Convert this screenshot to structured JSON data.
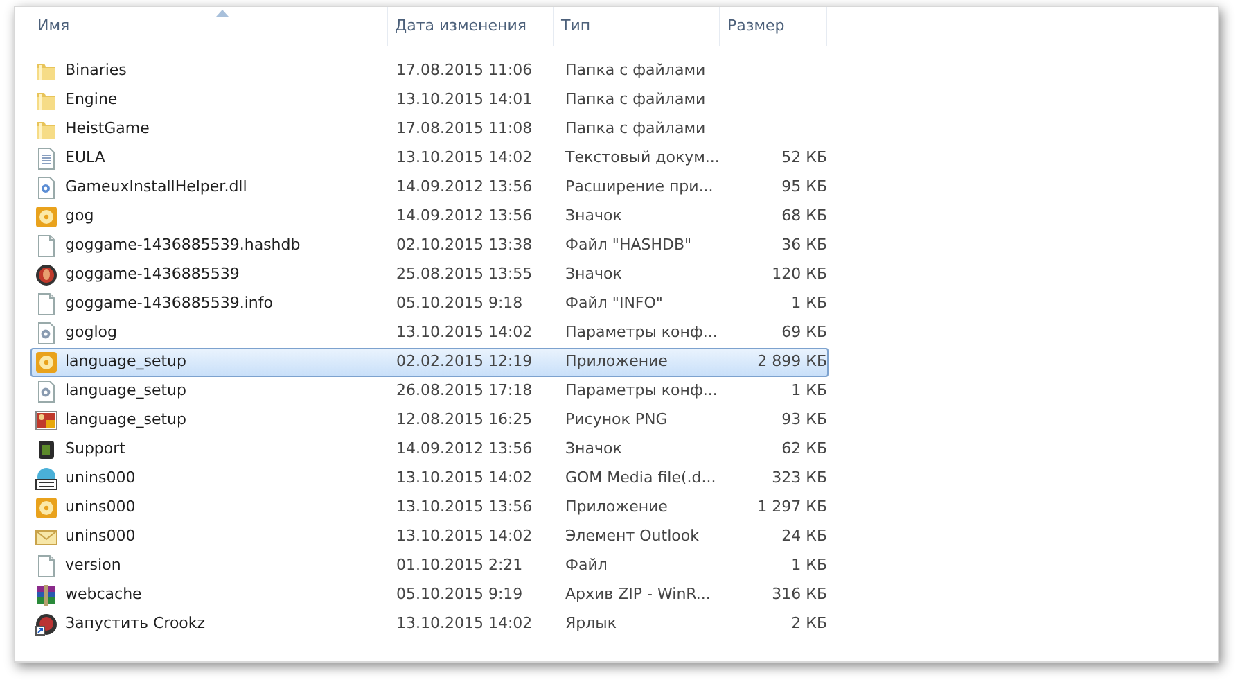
{
  "columns": [
    {
      "label": "Имя",
      "sorted": true
    },
    {
      "label": "Дата изменения",
      "sorted": false
    },
    {
      "label": "Тип",
      "sorted": false
    },
    {
      "label": "Размер",
      "sorted": false
    }
  ],
  "files": [
    {
      "name": "Binaries",
      "date": "17.08.2015 11:06",
      "type": "Папка с файлами",
      "kind": "folder",
      "selected": false
    },
    {
      "name": "Engine",
      "date": "13.10.2015 14:01",
      "type": "Папка с файлами",
      "kind": "folder",
      "selected": false
    },
    {
      "name": "HeistGame",
      "date": "17.08.2015 11:08",
      "type": "Папка с файлами",
      "kind": "folder",
      "selected": false
    },
    {
      "name": "EULA",
      "date": "13.10.2015 14:02",
      "type": "Текстовый докум...",
      "size": "52 КБ",
      "kind": "text",
      "selected": false
    },
    {
      "name": "GameuxInstallHelper.dll",
      "date": "14.09.2012 13:56",
      "type": "Расширение при...",
      "size": "95 КБ",
      "kind": "dll",
      "selected": false
    },
    {
      "name": "gog",
      "date": "14.09.2012 13:56",
      "type": "Значок",
      "size": "68 КБ",
      "kind": "disc",
      "selected": false
    },
    {
      "name": "goggame-1436885539.hashdb",
      "date": "02.10.2015 13:38",
      "type": "Файл \"HASHDB\"",
      "size": "36 КБ",
      "kind": "blank",
      "selected": false
    },
    {
      "name": "goggame-1436885539",
      "date": "25.08.2015 13:55",
      "type": "Значок",
      "size": "120 КБ",
      "kind": "round",
      "selected": false
    },
    {
      "name": "goggame-1436885539.info",
      "date": "05.10.2015 9:18",
      "type": "Файл \"INFO\"",
      "size": "1 КБ",
      "kind": "blank",
      "selected": false
    },
    {
      "name": "goglog",
      "date": "13.10.2015 14:02",
      "type": "Параметры конф...",
      "size": "69 КБ",
      "kind": "config",
      "selected": false
    },
    {
      "name": "language_setup",
      "date": "02.02.2015 12:19",
      "type": "Приложение",
      "size": "2 899 КБ",
      "kind": "disc",
      "selected": true
    },
    {
      "name": "language_setup",
      "date": "26.08.2015 17:18",
      "type": "Параметры конф...",
      "size": "1 КБ",
      "kind": "config",
      "selected": false
    },
    {
      "name": "language_setup",
      "date": "12.08.2015 16:25",
      "type": "Рисунок PNG",
      "size": "93 КБ",
      "kind": "image",
      "selected": false
    },
    {
      "name": "Support",
      "date": "14.09.2012 13:56",
      "type": "Значок",
      "size": "62 КБ",
      "kind": "support",
      "selected": false
    },
    {
      "name": "unins000",
      "date": "13.10.2015 14:02",
      "type": "GOM Media file(.d...",
      "size": "323 КБ",
      "kind": "dat",
      "selected": false
    },
    {
      "name": "unins000",
      "date": "13.10.2015 13:56",
      "type": "Приложение",
      "size": "1 297 КБ",
      "kind": "disc",
      "selected": false
    },
    {
      "name": "unins000",
      "date": "13.10.2015 14:02",
      "type": "Элемент Outlook",
      "size": "24 КБ",
      "kind": "mail",
      "selected": false
    },
    {
      "name": "version",
      "date": "01.10.2015 2:21",
      "type": "Файл",
      "size": "1 КБ",
      "kind": "blank",
      "selected": false
    },
    {
      "name": "webcache",
      "date": "05.10.2015 9:19",
      "type": "Архив ZIP - WinR...",
      "size": "316 КБ",
      "kind": "archive",
      "selected": false
    },
    {
      "name": "Запустить Crookz",
      "date": "13.10.2015 14:02",
      "type": "Ярлык",
      "size": "2 КБ",
      "kind": "shortcut",
      "selected": false
    }
  ]
}
